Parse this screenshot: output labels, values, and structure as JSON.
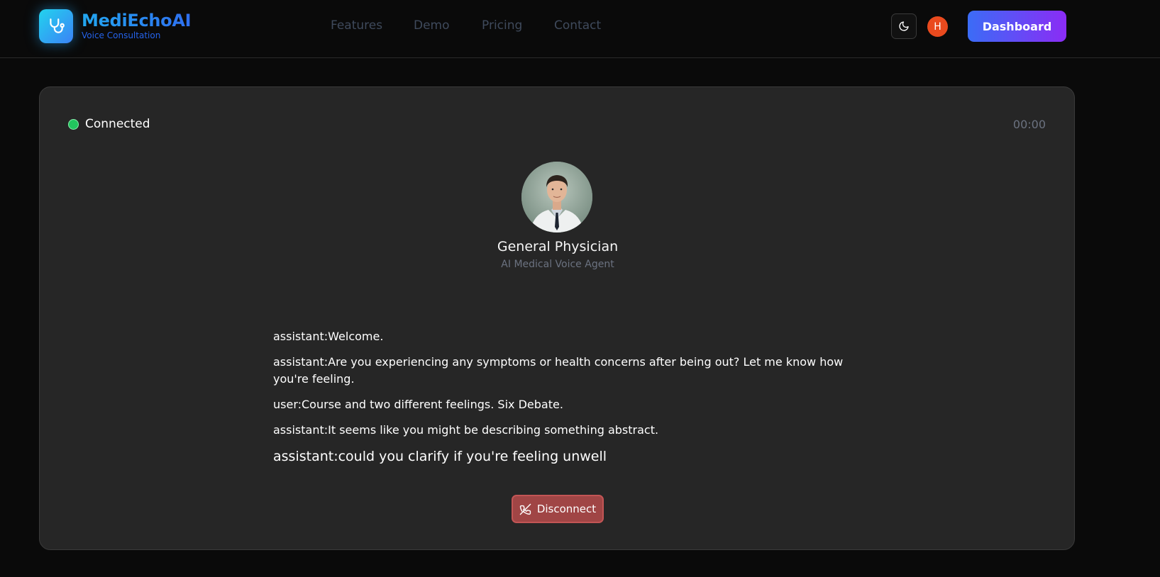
{
  "header": {
    "brand": "MediEchoAI",
    "tagline": "Voice Consultation",
    "nav": [
      {
        "label": "Features"
      },
      {
        "label": "Demo"
      },
      {
        "label": "Pricing"
      },
      {
        "label": "Contact"
      }
    ],
    "theme_icon": "moon-icon",
    "user_initial": "H",
    "dashboard_label": "Dashboard"
  },
  "session": {
    "status": "Connected",
    "timer": "00:00"
  },
  "agent": {
    "name": "General Physician",
    "role": "AI Medical Voice Agent"
  },
  "transcript": [
    {
      "text": "assistant:Welcome."
    },
    {
      "text": "assistant:Are you experiencing any symptoms or health concerns after being out? Let me know how you're feeling."
    },
    {
      "text": "user:Course and two different feelings. Six Debate."
    },
    {
      "text": "assistant:It seems like you might be describing something abstract."
    }
  ],
  "live_message": "assistant:could you clarify if you're feeling unwell",
  "actions": {
    "disconnect_label": "Disconnect",
    "disconnect_icon": "phone-off-icon"
  },
  "colors": {
    "background": "#0a0a0a",
    "card": "#262626",
    "status_green": "#22c55e",
    "disconnect_red": "#a04545",
    "dashboard_gradient_start": "#3b6cf6",
    "dashboard_gradient_end": "#8b2cf5"
  }
}
